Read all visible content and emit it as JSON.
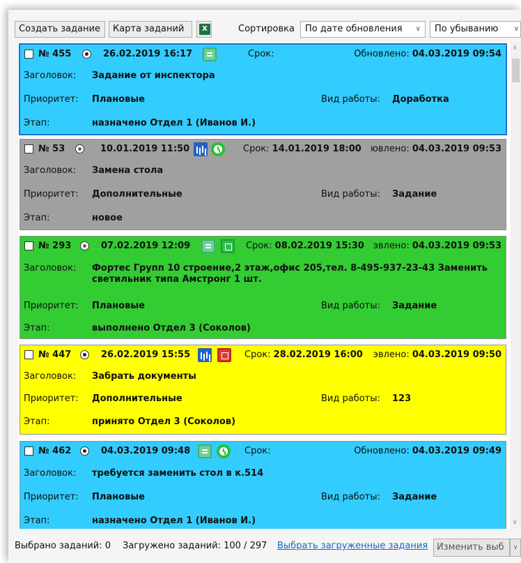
{
  "toolbar": {
    "create_label": "Создать задание",
    "map_label": "Карта заданий",
    "excel_icon": "excel-icon",
    "sort_label": "Сортировка",
    "sort_field": "По дате обновления",
    "sort_order": "По убыванию"
  },
  "labels": {
    "title": "Заголовок:",
    "priority": "Приоритет:",
    "stage": "Этап:",
    "work_type": "Вид работы:"
  },
  "tasks": [
    {
      "check_num": "№ 455",
      "date": "26.02.2019 16:17",
      "icons": [
        "document-icon"
      ],
      "srok": "Срок:",
      "srok_value": "",
      "updated_prefix": "Обновлено: ",
      "updated_value": "04.03.2019 09:54",
      "title": "Задание от инспектора",
      "priority": "Плановые",
      "work_type": "Доработка",
      "stage": "назначено Отдел 1 (Иванов И.)",
      "color": "#33ccff"
    },
    {
      "check_num": "№ 53",
      "date": "10.01.2019 11:50",
      "icons": [
        "bar-chart-icon",
        "clock-icon"
      ],
      "srok": "Срок: ",
      "srok_value": "14.01.2019 18:00",
      "updated_prefix": "ювлено: ",
      "updated_value": "04.03.2019 09:53",
      "title": "Замена стола",
      "priority": "Дополнительные",
      "work_type": "Задание",
      "stage": "новое",
      "color": "#a0a0a0"
    },
    {
      "check_num": "№ 293",
      "date": "07.02.2019 12:09",
      "icons": [
        "document-icon",
        "green-box-icon"
      ],
      "srok": "Срок: ",
      "srok_value": "08.02.2019 15:30",
      "updated_prefix": "эвлено: ",
      "updated_value": "04.03.2019 09:53",
      "title": "Фортес Групп 10 строение,2 этаж,офис 205,тел. 8-495-937-23-43 Заменить светильник типа Амстронг 1 шт.",
      "priority": "Плановые",
      "work_type": "Задание",
      "stage": "выполнено Отдел 3 (Соколов)",
      "color": "#33cc33"
    },
    {
      "check_num": "№ 447",
      "date": "26.02.2019 15:55",
      "icons": [
        "bar-chart-icon",
        "red-box-icon"
      ],
      "srok": "Срок: ",
      "srok_value": "28.02.2019 16:00",
      "updated_prefix": "эвлено: ",
      "updated_value": "04.03.2019 09:50",
      "title": "Забрать документы",
      "priority": "Дополнительные",
      "work_type": "123",
      "stage": "принято Отдел 3 (Соколов)",
      "color": "#ffff00"
    },
    {
      "check_num": "№ 462",
      "date": "04.03.2019 09:48",
      "icons": [
        "document-icon",
        "clock-icon"
      ],
      "srok": "Срок:",
      "srok_value": "",
      "updated_prefix": "Обновлено: ",
      "updated_value": "04.03.2019 09:49",
      "title": "требуется заменить стол в к.514",
      "priority": "Плановые",
      "work_type": "Задание",
      "stage": "назначено Отдел 1 (Иванов И.)",
      "color": "#33ccff"
    }
  ],
  "footer": {
    "selected": "Выбрано заданий: 0",
    "loaded": "Загружено заданий: 100 / 297",
    "select_loaded_link": "Выбрать загруженные задания",
    "change_button": "Изменить выб"
  }
}
